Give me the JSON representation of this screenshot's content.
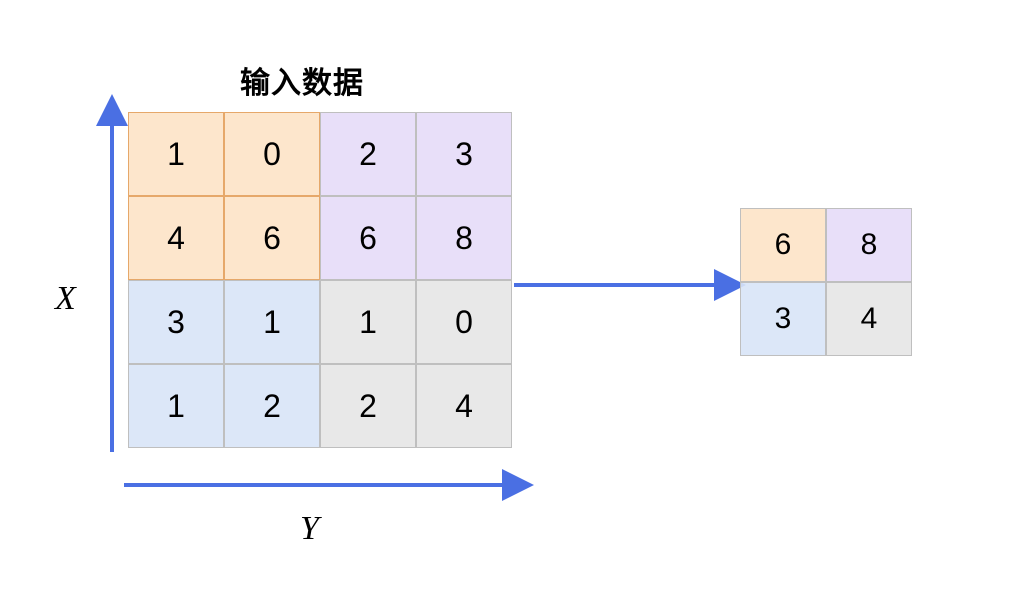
{
  "title": "输入数据",
  "axis": {
    "x": "X",
    "y": "Y"
  },
  "input": {
    "rows": [
      [
        "1",
        "0",
        "2",
        "3"
      ],
      [
        "4",
        "6",
        "6",
        "8"
      ],
      [
        "3",
        "1",
        "1",
        "0"
      ],
      [
        "1",
        "2",
        "2",
        "4"
      ]
    ]
  },
  "output": {
    "rows": [
      [
        "6",
        "8"
      ],
      [
        "3",
        "4"
      ]
    ]
  },
  "colors": {
    "arrow": "#4a6fe3",
    "orange": "#fde2c3",
    "purple": "#e6dcf8",
    "blue": "#d8e4f7",
    "gray": "#e6e6e6"
  }
}
